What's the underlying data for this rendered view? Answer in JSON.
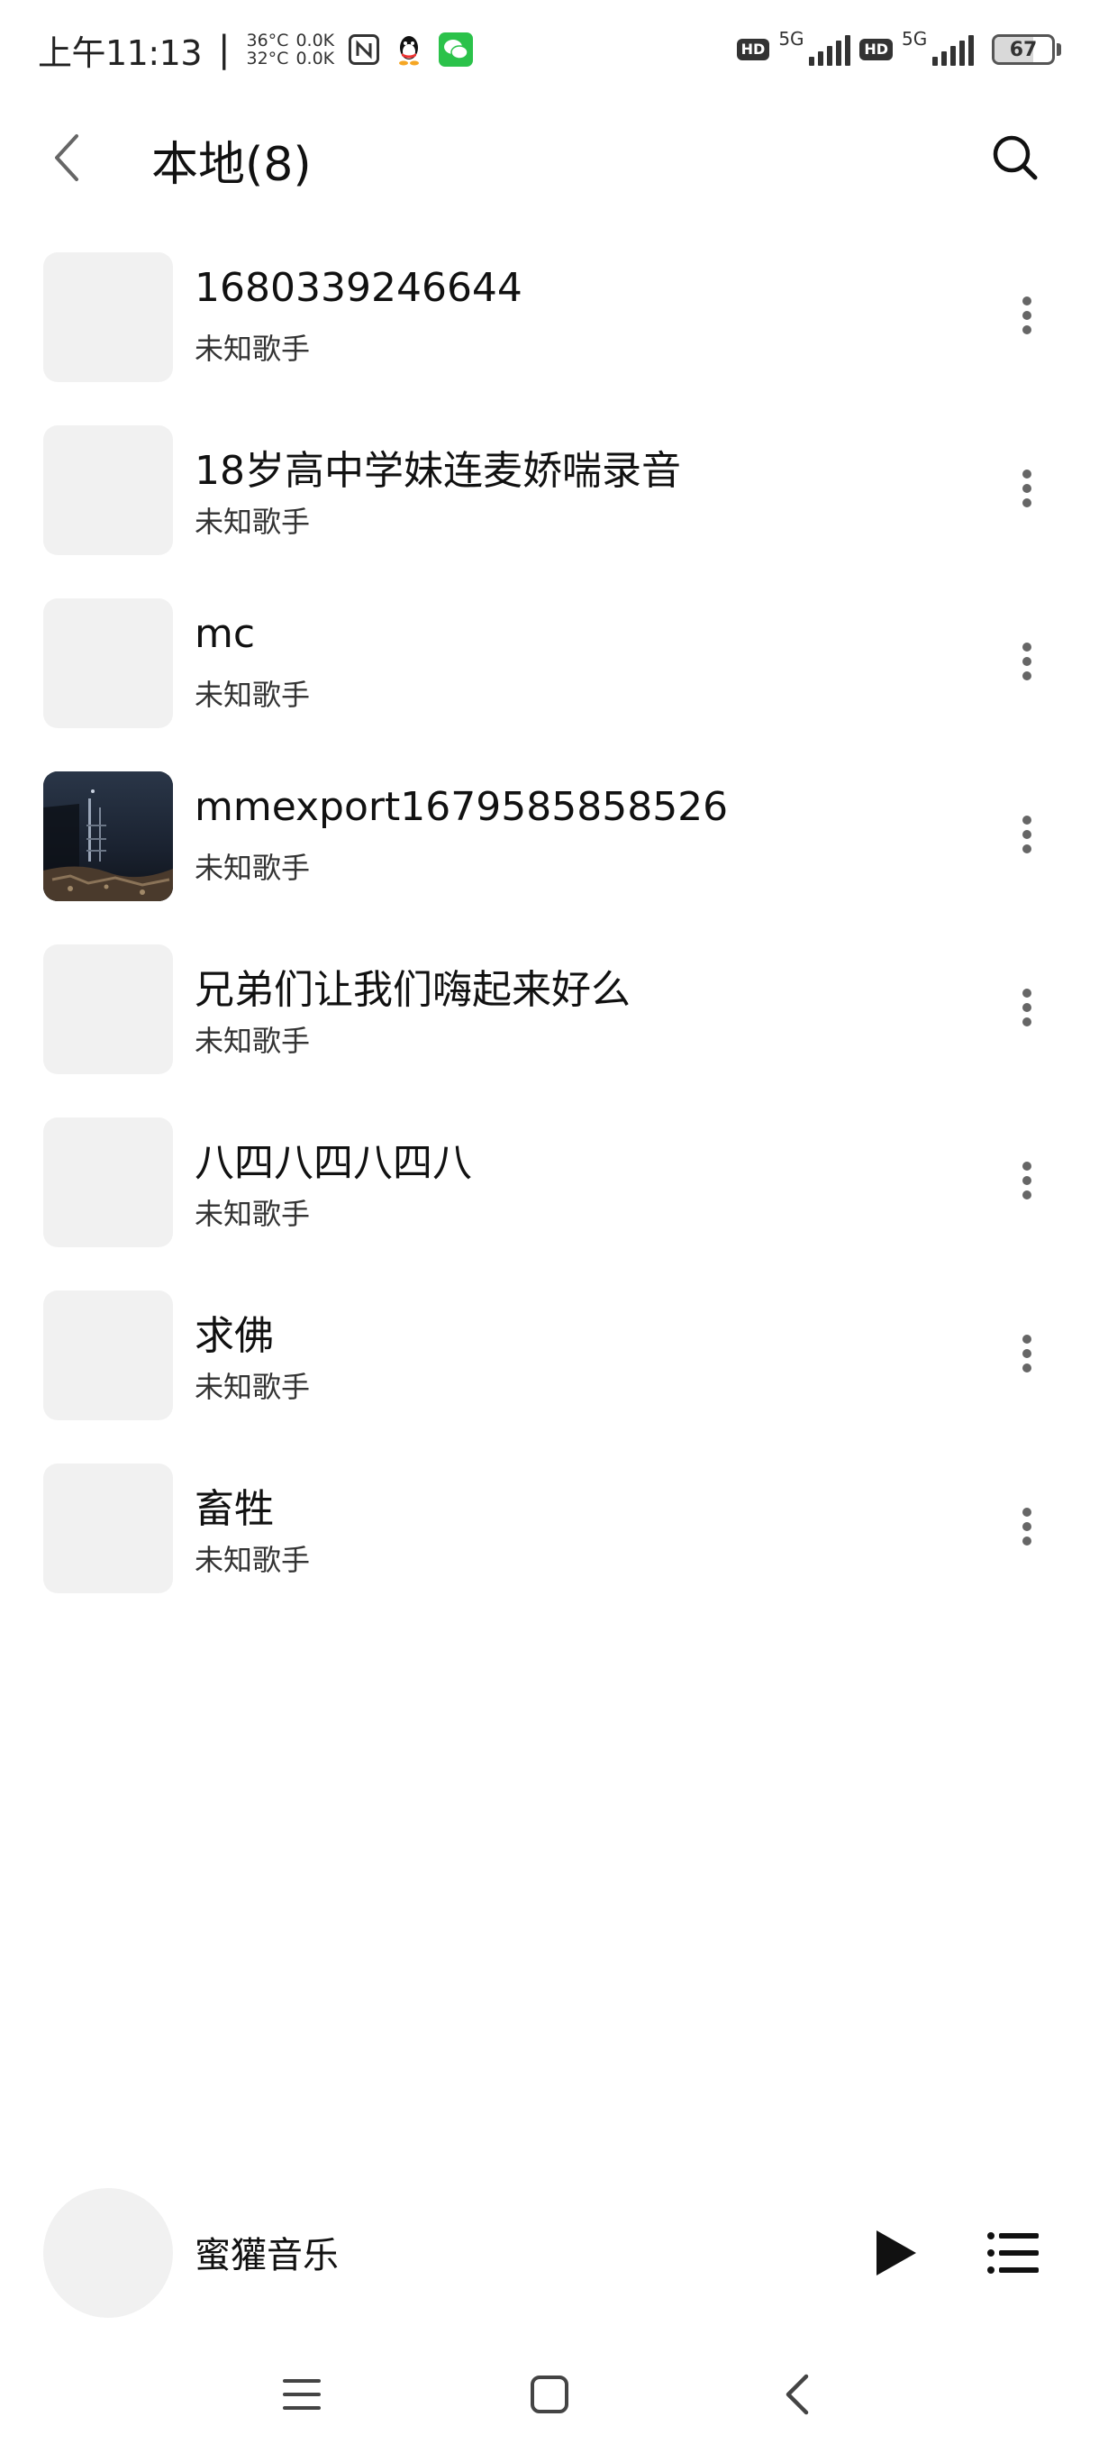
{
  "status_bar": {
    "time": "上午11:13",
    "separator": "|",
    "temp_top": "36°C",
    "speed_top": "0.0K",
    "temp_bottom": "32°C",
    "speed_bottom": "0.0K",
    "sim1_badge": "HD",
    "sim1_network": "5G",
    "sim2_badge": "HD",
    "sim2_network": "5G",
    "battery_level": "67",
    "battery_percent": 67,
    "icons": [
      "nfc-icon",
      "qq-icon",
      "wechat-icon",
      "signal-icon",
      "battery-icon"
    ]
  },
  "header": {
    "title": "本地(8)",
    "back_icon": "chevron-left-icon",
    "search_icon": "search-icon"
  },
  "songs": [
    {
      "title": "1680339246644",
      "artist": "未知歌手",
      "has_cover": false
    },
    {
      "title": "18岁高中学妹连麦娇喘录音",
      "artist": "未知歌手",
      "has_cover": false
    },
    {
      "title": "mc",
      "artist": "未知歌手",
      "has_cover": false
    },
    {
      "title": "mmexport1679585858526",
      "artist": "未知歌手",
      "has_cover": true
    },
    {
      "title": "兄弟们让我们嗨起来好么",
      "artist": "未知歌手",
      "has_cover": false
    },
    {
      "title": "八四八四八四八",
      "artist": "未知歌手",
      "has_cover": false
    },
    {
      "title": "求佛",
      "artist": "未知歌手",
      "has_cover": false
    },
    {
      "title": "畜牲",
      "artist": "未知歌手",
      "has_cover": false
    }
  ],
  "mini_player": {
    "name": "蜜獾音乐",
    "play_icon": "play-icon",
    "queue_icon": "playlist-icon"
  },
  "nav_bar": {
    "icons": [
      "menu-icon",
      "home-icon",
      "back-icon"
    ]
  },
  "colors": {
    "background": "#ffffff",
    "placeholder": "#f1f1f1",
    "text_primary": "#111111",
    "text_secondary": "#333333",
    "wechat_green": "#2bc24a"
  }
}
